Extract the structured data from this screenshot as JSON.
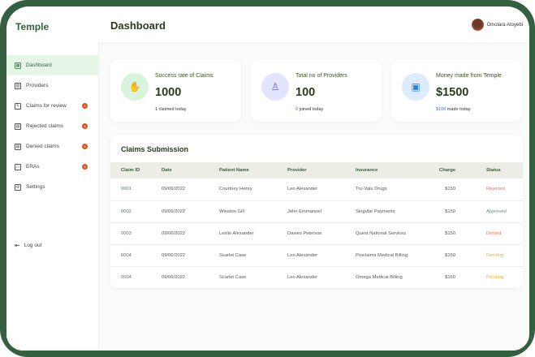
{
  "app": {
    "name": "Temple"
  },
  "sidebar": {
    "items": [
      {
        "label": "Dashboard",
        "icon": "grid-icon",
        "active": true
      },
      {
        "label": "Providers",
        "icon": "building-icon"
      },
      {
        "label": "Claims for review",
        "icon": "document-edit-icon",
        "badge": "5"
      },
      {
        "label": "Rejected claims",
        "icon": "document-x-icon",
        "badge": "5"
      },
      {
        "label": "Denied claims",
        "icon": "document-block-icon",
        "badge": "5"
      },
      {
        "label": "ERAs",
        "icon": "money-icon",
        "badge": "5"
      },
      {
        "label": "Settings",
        "icon": "gear-icon"
      }
    ],
    "logout": "Log out"
  },
  "header": {
    "title": "Dashboard",
    "user": "Omolara Atoyebi"
  },
  "cards": [
    {
      "label": "Success rate of Claims",
      "value": "1000",
      "sub_highlight": "",
      "sub": "1 claimed today",
      "color": "#d8f5dc",
      "icon": "hand-coins-icon"
    },
    {
      "label": "Total no of Providers",
      "value": "100",
      "sub_highlight": "0",
      "sub": " joined today",
      "color": "#e3e4fd",
      "icon": "provider-icon",
      "highlight_color": "#5a5cf0"
    },
    {
      "label": "Money made from Temple",
      "value": "$1500",
      "sub_highlight": "$100",
      "sub": " made today",
      "color": "#dcecfd",
      "icon": "banknote-icon",
      "highlight_color": "#2f80ed"
    }
  ],
  "claims": {
    "title": "Claims Submission",
    "columns": [
      "Claim ID",
      "Date",
      "Patient Name",
      "Provider",
      "Insurance",
      "Charge",
      "Status"
    ],
    "rows": [
      [
        "0001",
        "09/06/2022",
        "Courtney Henry",
        "Leo Alexander",
        "Tru-Valu Drugs",
        "$150",
        "Rejected"
      ],
      [
        "0002",
        "09/06/2022",
        "Winston Gill",
        "John Emmanuel",
        "Singular Payments",
        "$150",
        "Approved"
      ],
      [
        "0003",
        "09/06/2022",
        "Leslie Alexander",
        "Davies Peterson",
        "Quest National Services",
        "$150",
        "Denied"
      ],
      [
        "0004",
        "09/06/2022",
        "Scarlet Case",
        "Leo Alexander",
        "Proclaims Medical Billing",
        "$150",
        "Pending"
      ],
      [
        "0004",
        "09/06/2022",
        "Scarlet Case",
        "Leo Alexander",
        "Omega Medical Billing",
        "$150",
        "Pending"
      ]
    ]
  },
  "status_colors": {
    "Rejected": "#ef6b5a",
    "Approved": "#4f9a68",
    "Denied": "#ef6b5a",
    "Pending": "#f2b133"
  }
}
